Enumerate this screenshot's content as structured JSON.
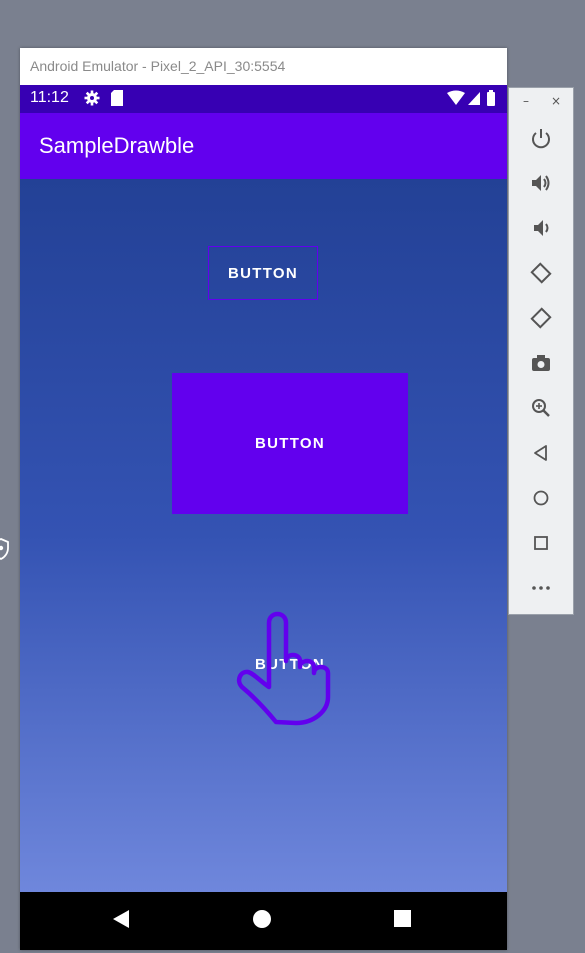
{
  "window": {
    "title": "Android Emulator - Pixel_2_API_30:5554"
  },
  "status_bar": {
    "time": "11:12"
  },
  "app_bar": {
    "title": "SampleDrawble"
  },
  "buttons": [
    {
      "label": "BUTTON",
      "style": "outlined"
    },
    {
      "label": "BUTTON",
      "style": "filled"
    },
    {
      "label": "BUTTON",
      "style": "text"
    }
  ],
  "side_panel": {
    "window_controls": {
      "minimize": "–",
      "close": "×"
    },
    "tools": [
      "power-icon",
      "volume-up-icon",
      "volume-down-icon",
      "rotate-left-icon",
      "rotate-right-icon",
      "camera-icon",
      "zoom-icon",
      "back-icon",
      "home-icon",
      "overview-icon",
      "more-icon"
    ]
  },
  "colors": {
    "primary": "#6200ee",
    "primary_dark": "#3700b3",
    "gradient_top": "#234196",
    "gradient_bottom": "#6f87dc"
  }
}
